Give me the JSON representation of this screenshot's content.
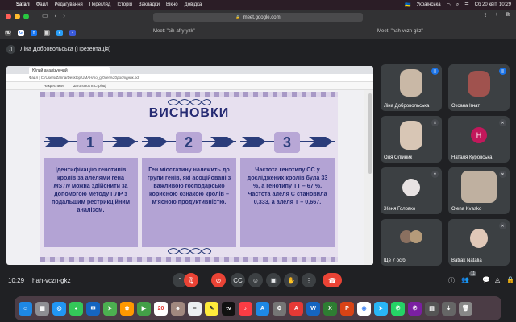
{
  "menubar": {
    "app": "Safari",
    "items": [
      "Файл",
      "Редагування",
      "Перегляд",
      "Історія",
      "Закладки",
      "Вікно",
      "Довідка"
    ],
    "input_source": "Українська",
    "clock": "Сб 20 квіт. 10:29"
  },
  "browser": {
    "url": "meet.google.com",
    "tabs": [
      "Meet: \"cih-afry-yzk\"",
      "Meet: \"hah-vczn-gkz\""
    ]
  },
  "meet": {
    "presenter": "Ліна Добровольська (Презентація)",
    "presenter_initial": "Л",
    "time": "10:29",
    "meeting_code": "hah-vczn-gkz",
    "participant_count": "11"
  },
  "shared": {
    "tab_title": "Юлий аналізуючий",
    "path": "Файл  |  C:/Users/Zarina/Desktop/UMAH/no_gr0ver%20дослідник.pdf",
    "pdf_tools": [
      "Накреслити",
      "Заголовок в Стрічці"
    ],
    "slide": {
      "title": "ВИСНОВКИ",
      "columns": [
        {
          "number": "1",
          "pre": "Ідентифікацію генотипів кролів за алелями гена ",
          "italic": "MSTN",
          "post": " можна здійснити за допомогою методу ПЛР з подальшим рестрикційним аналізом."
        },
        {
          "number": "2",
          "pre": "Ген міостатину належить до групи генів, які асоційовані з важливою господарсько корисною ознакою кролів – м'ясною продуктивністю.",
          "italic": "",
          "post": ""
        },
        {
          "number": "3",
          "pre": "Частота генотипу CC у досліджених кролів була 33 %, а генотипу TT – 67 %. Частота алеля C становила 0,333, а алеля T – 0,667.",
          "italic": "",
          "post": ""
        }
      ]
    }
  },
  "participants": [
    {
      "name": "Ліна Добровольська",
      "kind": "photo",
      "color": "#c9b8a6"
    },
    {
      "name": "Оксана Ігнат",
      "kind": "photo",
      "color": "#a0524e"
    },
    {
      "name": "Оля Олійник",
      "kind": "photo",
      "color": "#d8c6b5"
    },
    {
      "name": "Наталя Куровська",
      "kind": "initial",
      "initial": "Н",
      "color": "#c2185b"
    },
    {
      "name": "Женя Головко",
      "kind": "photo",
      "color": "#e7e2e2"
    },
    {
      "name": "Olena Kvasko",
      "kind": "photo",
      "color": "#bfb0a0"
    },
    {
      "name": "Ще 7 осіб",
      "kind": "group",
      "color": "#8a7060"
    },
    {
      "name": "Batrak Natalia",
      "kind": "photo",
      "color": "#e0c8b8"
    }
  ],
  "colors": {
    "meet_bg": "#202124",
    "tile_bg": "#3c4043",
    "end_call": "#ea4335",
    "slide_text": "#252a72",
    "slide_box": "#b3a3d4"
  }
}
